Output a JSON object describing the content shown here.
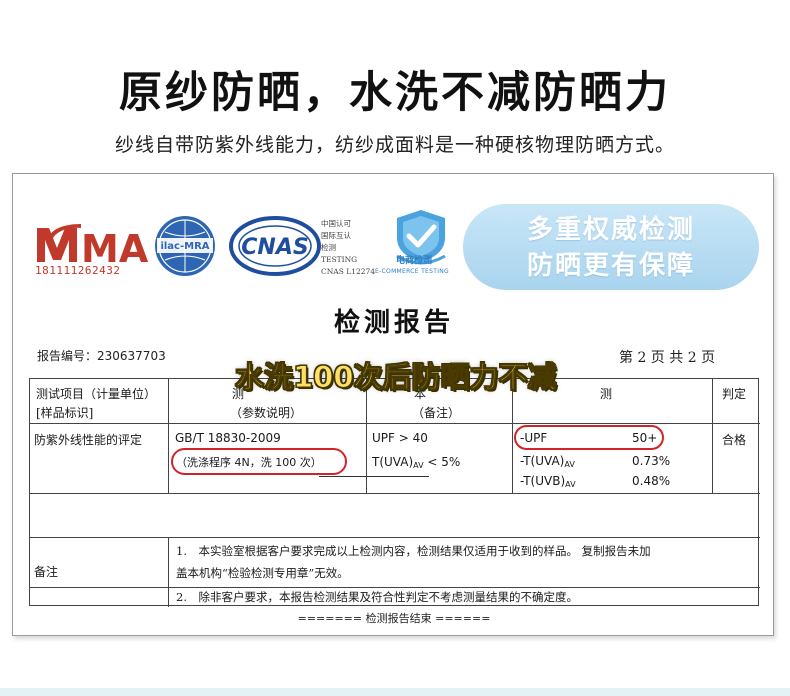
{
  "headline": "原纱防晒，水洗不减防晒力",
  "subline": "纱线自带防紫外线能力，纺纱成面料是一种硬核物理防晒方式。",
  "logos": {
    "cma_text": "MA",
    "cma_number": "181111262432",
    "ilac_text": "ilac-MRA",
    "cnas_text": "CNAS",
    "cnas_info": [
      "中国认可",
      "国际互认",
      "检测",
      "TESTING",
      "CNAS L12274"
    ],
    "ecommerce_cn": "电商检测",
    "ecommerce_en": "E-COMMERCE TESTING"
  },
  "authority_badge": {
    "line1": "多重权威检测",
    "line2": "防晒更有保障"
  },
  "report": {
    "title": "检测报告",
    "number_label": "报告编号：230637703",
    "page_label": "第 2 页 共 2 页",
    "overlay_banner": "水洗100次后防晒力不减",
    "headers": {
      "item_line1": "测试项目（计量单位）",
      "item_line2": "[样品标识]",
      "method_line1": "测",
      "method_line2": "（参数说明）",
      "req_line1": "本",
      "req_line2": "（备注）",
      "result": "测",
      "judgement": "判定"
    },
    "row": {
      "item": "防紫外线性能的评定",
      "standard": "GB/T 18830-2009",
      "wash": "（洗涤程序 4N，洗 100 次）",
      "req1": "UPF > 40",
      "req2_main": "T(UVA)",
      "req2_sub": "AV",
      "req2_tail": " < 5%",
      "results": [
        {
          "label": "-UPF",
          "sub": "",
          "value": "50+"
        },
        {
          "label": "-T(UVA)",
          "sub": "AV",
          "value": "0.73%"
        },
        {
          "label": "-T(UVB)",
          "sub": "AV",
          "value": "0.48%"
        }
      ],
      "judgement": "合格"
    },
    "remarks_label": "备注",
    "remarks": [
      "1.　本实验室根据客户要求完成以上检测内容，检测结果仅适用于收到的样品。 复制报告未加",
      "盖本机构“检验检测专用章”无效。",
      "2.　除非客户要求，本报告检测结果及符合性判定不考虑测量结果的不确定度。"
    ],
    "end_line": "======= 检测报告结束 ======"
  },
  "colors": {
    "cma_red": "#c0392b",
    "oval_red": "#d2232a",
    "cnas_blue": "#1f4e9e",
    "badge_blue": "#a9d4ee",
    "banner_yellow": "#ffe066"
  }
}
